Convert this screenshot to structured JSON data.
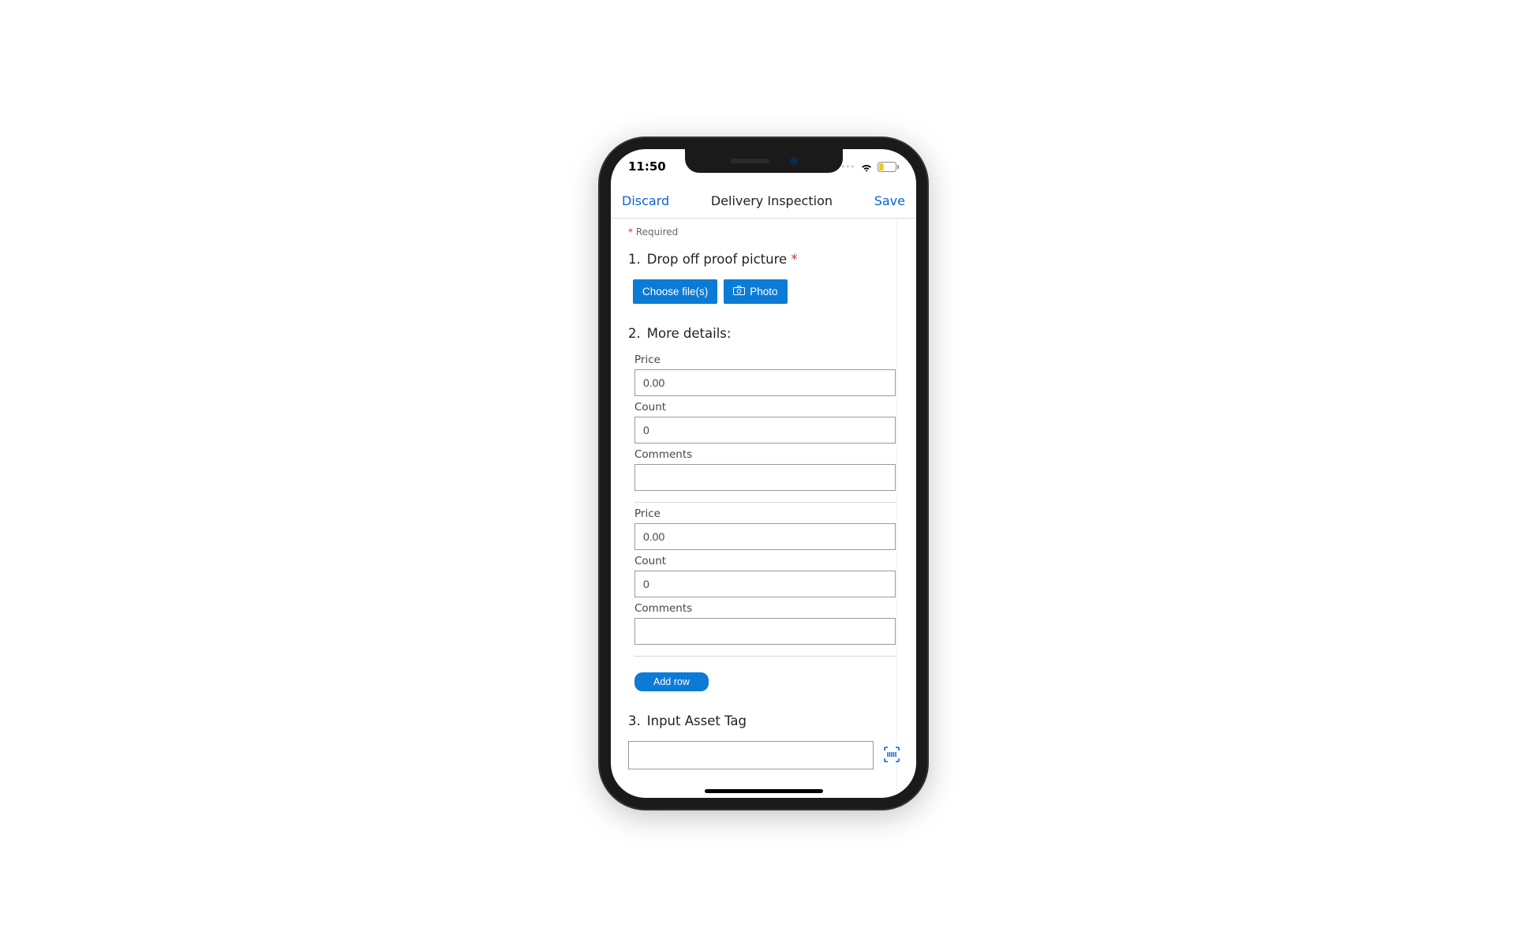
{
  "status": {
    "time": "11:50"
  },
  "nav": {
    "discard": "Discard",
    "title": "Delivery Inspection",
    "save": "Save"
  },
  "requiredText": "Required",
  "questions": {
    "q1": {
      "num": "1.",
      "label": "Drop off proof picture"
    },
    "q2": {
      "num": "2.",
      "label": "More details:"
    },
    "q3": {
      "num": "3.",
      "label": "Input Asset Tag"
    }
  },
  "buttons": {
    "chooseFiles": "Choose file(s)",
    "photo": "Photo",
    "addRow": "Add row"
  },
  "fields": {
    "priceLabel": "Price",
    "priceValue": "0.00",
    "countLabel": "Count",
    "countValue": "0",
    "commentsLabel": "Comments",
    "commentsValue": ""
  },
  "assetTagValue": ""
}
